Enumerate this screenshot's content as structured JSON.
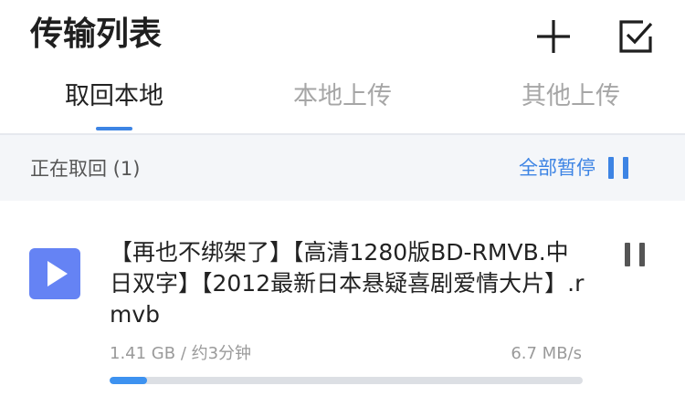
{
  "header": {
    "title": "传输列表",
    "add_icon": "plus-icon",
    "select_icon": "checkbox-icon"
  },
  "tabs": [
    {
      "label": "取回本地",
      "active": true
    },
    {
      "label": "本地上传",
      "active": false
    },
    {
      "label": "其他上传",
      "active": false
    }
  ],
  "section": {
    "title": "正在取回 (1)",
    "pause_all_label": "全部暂停",
    "pause_icon": "pause-icon"
  },
  "transfer": {
    "file_icon": "play-icon",
    "file_name": "【再也不绑架了】【高清1280版BD-RMVB.中日双字】【2012最新日本悬疑喜剧爱情大片】.rmvb",
    "size_eta": "1.41 GB / 约3分钟",
    "speed": "6.7 MB/s",
    "progress": 0.08,
    "pause_icon": "pause-icon"
  },
  "colors": {
    "accent": "#3d84e4",
    "file_icon_bg": "#6583f4",
    "section_bg": "#f4f6f9",
    "inactive_tab": "#a6a6a6"
  }
}
